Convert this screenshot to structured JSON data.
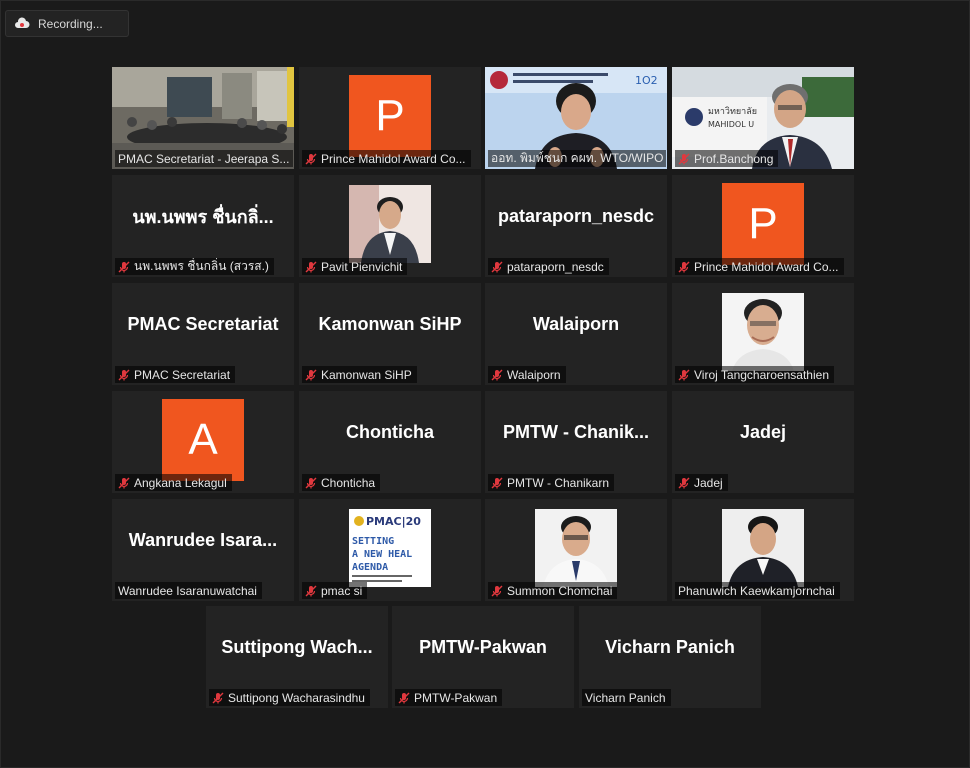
{
  "recording": {
    "label": "Recording..."
  },
  "participants": [
    {
      "label": "PMAC Secretariat - Jeerapa S...",
      "muted": false
    },
    {
      "label": "Prince Mahidol Award Co...",
      "muted": true,
      "avatar_letter": "P"
    },
    {
      "label": "ออท. พิมพ์ชนก คผท. WTO/WIPO",
      "muted": false,
      "active_speaker": true
    },
    {
      "label": "Prof.Banchong",
      "muted": true
    },
    {
      "label": "นพ.นพพร ชื่นกลิ่น (สวรส.)",
      "muted": true,
      "display_name": "นพ.นพพร ชื่นกลิ่..."
    },
    {
      "label": "Pavit Pienvichit",
      "muted": true
    },
    {
      "label": "pataraporn_nesdc",
      "muted": true,
      "display_name": "pataraporn_nesdc"
    },
    {
      "label": "Prince Mahidol Award Co...",
      "muted": true,
      "avatar_letter": "P"
    },
    {
      "label": "PMAC Secretariat",
      "muted": true,
      "display_name": "PMAC Secretariat"
    },
    {
      "label": "Kamonwan SiHP",
      "muted": true,
      "display_name": "Kamonwan SiHP"
    },
    {
      "label": "Walaiporn",
      "muted": true,
      "display_name": "Walaiporn"
    },
    {
      "label": "Viroj Tangcharoensathien",
      "muted": true
    },
    {
      "label": "Angkana Lekagul",
      "muted": true,
      "avatar_letter": "A"
    },
    {
      "label": "Chonticha",
      "muted": true,
      "display_name": "Chonticha"
    },
    {
      "label": "PMTW - Chanikarn",
      "muted": true,
      "display_name": "PMTW  -  Chanik..."
    },
    {
      "label": "Jadej",
      "muted": true,
      "display_name": "Jadej"
    },
    {
      "label": "Wanrudee Isaranuwatchai",
      "muted": false,
      "display_name": "Wanrudee  Isara..."
    },
    {
      "label": "pmac si",
      "muted": true
    },
    {
      "label": "Summon Chomchai",
      "muted": true
    },
    {
      "label": "Phanuwich Kaewkamjornchai",
      "muted": false
    },
    {
      "label": "Suttipong Wacharasindhu",
      "muted": true,
      "display_name": "Suttipong  Wach..."
    },
    {
      "label": "PMTW-Pakwan",
      "muted": true,
      "display_name": "PMTW-Pakwan"
    },
    {
      "label": "Vicharn Panich",
      "muted": false,
      "display_name": "Vicharn Panich"
    }
  ],
  "video_text": {
    "banchong_sign": "มหาวิทยาลัย",
    "banchong_sign_sub": "MAHIDOL U",
    "wto_banner": "1O2",
    "pmac_slide_line1": "PMAC|20",
    "pmac_slide_line2": "SETTING",
    "pmac_slide_line3": "A NEW HEAL",
    "pmac_slide_line4": "AGENDA"
  },
  "colors": {
    "avatar_bg": "#f0561f",
    "active_border": "#d8e84c",
    "tile_bg": "#232323",
    "mute_red": "#e0383e"
  }
}
